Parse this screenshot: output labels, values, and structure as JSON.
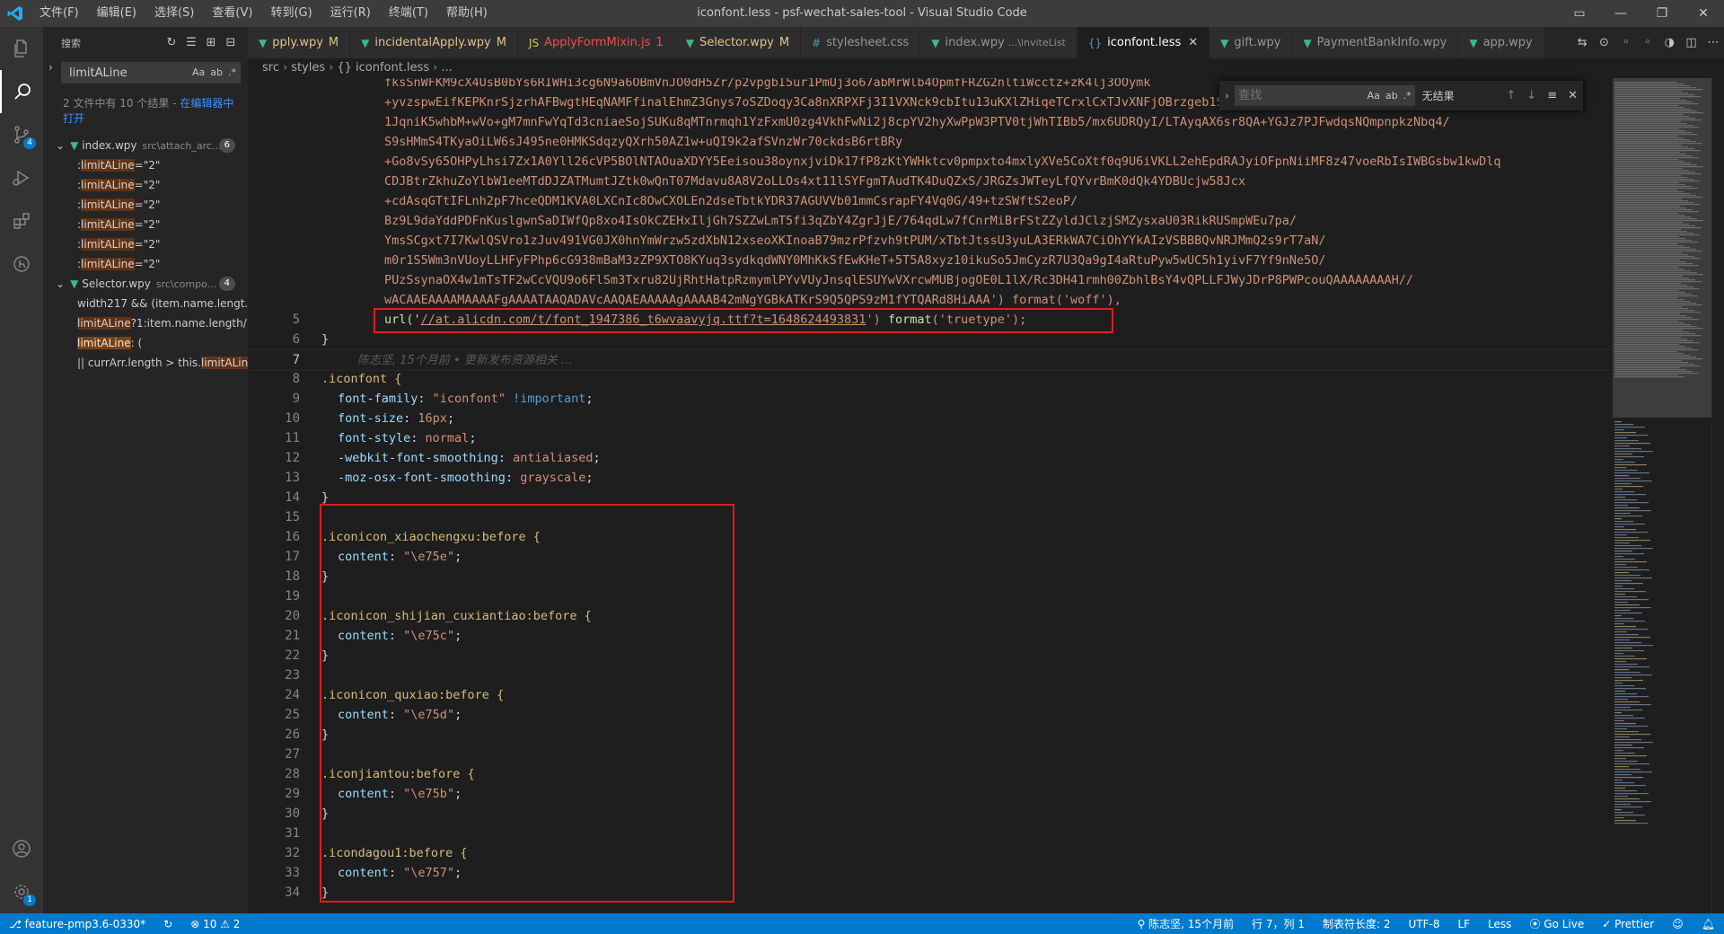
{
  "window": {
    "title": "iconfont.less - psf-wechat-sales-tool - Visual Studio Code",
    "menu": [
      "文件(F)",
      "编辑(E)",
      "选择(S)",
      "查看(V)",
      "转到(G)",
      "运行(R)",
      "终端(T)",
      "帮助(H)"
    ]
  },
  "sidebar": {
    "title": "搜索",
    "search_value": "limitALine",
    "result_message": "2 文件中有 10 个结果 - ",
    "open_in_editor": "在编辑器中打开",
    "files": [
      {
        "name": "index.wpy",
        "path": "src\\attach_arc...",
        "count": "6",
        "matches": [
          ":limitALine=\"2\"",
          ":limitALine=\"2\"",
          ":limitALine=\"2\"",
          ":limitALine=\"2\"",
          ":limitALine=\"2\"",
          ":limitALine=\"2\""
        ]
      },
      {
        "name": "Selector.wpy",
        "path": "src\\compo...",
        "count": "4",
        "matches": [
          "width217 && (item.name.lengt...",
          "limitALine?1:item.name.length/...",
          "limitALine: (",
          "|| currArr.length > this.limitALin..."
        ]
      }
    ]
  },
  "tabs": [
    {
      "label": "pply.wpy",
      "mod": "M",
      "icon": "vue",
      "color": "#e2c08d"
    },
    {
      "label": "incidentalApply.wpy",
      "mod": "M",
      "icon": "vue",
      "color": "#e2c08d"
    },
    {
      "label": "ApplyFormMixin.js",
      "mod": "1",
      "icon": "js",
      "color": "#f14c4c"
    },
    {
      "label": "Selector.wpy",
      "mod": "M",
      "icon": "vue",
      "color": "#e2c08d"
    },
    {
      "label": "stylesheet.css",
      "mod": "",
      "icon": "css",
      "color": "#969696"
    },
    {
      "label": "index.wpy",
      "desc": "...\\inviteList",
      "mod": "",
      "icon": "vue",
      "color": "#969696"
    },
    {
      "label": "iconfont.less",
      "mod": "",
      "icon": "less",
      "color": "#ffffff",
      "active": true
    },
    {
      "label": "gift.wpy",
      "mod": "",
      "icon": "vue",
      "color": "#969696"
    },
    {
      "label": "PaymentBankInfo.wpy",
      "mod": "",
      "icon": "vue",
      "color": "#969696"
    },
    {
      "label": "app.wpy",
      "mod": "",
      "icon": "vue",
      "color": "#969696"
    }
  ],
  "breadcrumb": [
    "src",
    "styles",
    "{} iconfont.less",
    "..."
  ],
  "find": {
    "placeholder": "查找",
    "result": "无结果"
  },
  "editor": {
    "base64_lines": [
      "fksSnWFKM9cX4UsB0bYs6RIWHi3cg6N9a6OBmVnJO0dH5Zr/p2vpgbI5ur1PmUj3o67abMrWlb4OpmfFRZG2nltiWcctz+zK4lj3OOymk",
      "+yvzspwEifKEPKnrSjzrhAFBwgtHEqNAMFfinalEhmZ3Gnys7oSZDoqy3Ca8nXRPXFj3I1VXNck9cbItu13uKXlZHiqeTCrxlCxTJvXNFjOBrzgeb1Sddq9zqs01H1Ymmaqr5CG/bJ3PBFTs1/",
      "1JqniK5whbM+wVo+gM7mnFwYqTd3cniaeSojSUKu8qMTnrmqh1YzFxmU0zg4VkhFwNi2j8cpYV2hyXwPpW3PTV0tjWhTIBb5/mx6UDRQyI/LTAyqAX6sr8QA+YGJz7PJFwdqsNQmpnpkzNbq4/",
      "S9sHMmS4TKyaOiLW6sJ495ne0HMKSdqzyQXrh50AZ1w+uQI9k2afSVnzWr70ckdsB6rtBRy",
      "+Go8vSy65OHPyLhsi7Zx1A0Yll26cVP5BOlNTAOuaXDYY5Eeisou38oynxjviDk17fP8zKtYWHktcv0pmpxto4mxlyXVe5CoXtf0q9U6iVKLL2ehEpdRAJyiOFpnNiiMF8z47voeRbIsIWBGsbw1kwDlq",
      "CDJBtrZkhuZoYlbW1eeMTdDJZATMumtJZtk0wQnT07Mdavu8A8V2oLLOs4xt11lSYFgmTAudTK4DuQZxS/JRGZsJWTeyLfQYvrBmK0dQk4YDBUcjw58Jcx",
      "+cdAsqGTtIFLnh2pF7hceQDM1KVA0LXCnIc8OwCXOLEn2dseTbtkYDR37AGUVVb01mmCsrapFY4Vq0G/49+tzSWftS2eoP/",
      "Bz9L9daYddPDFnKuslgwnSaDIWfQp8xo4IsOkCZEHxIljGh7SZZwLmT5fi3qZbY4ZgrJjE/764qdLw7fCnrMiBrFStZZyldJClzjSMZysxaU03RikRUSmpWEu7pa/",
      "YmsSCgxt7I7KwlQSVro1zJuv491VG0JX0hnYmWrzw5zdXbN12xseoXKInoaB79mzrPfzvh9tPUM/xTbtJtssU3yuLA3ERkWA7CiOhYYkAIzVSBBBQvNRJMmQ2s9rT7aN/",
      "m0r1S5Wm3nVUoyLLHFyFPhp6cG938mBaM3zZP9XTO8KYuq3sydkqdWNY0MhKkSfEwKHeT+5T5A8xyz10ikuSo5JmCyzR7U3Qa9gI4aRtuPyw5wUC5h1yivF7Yf9nNe5O/",
      "PUzSsynaOX4w1mTsTF2wCcVQU9o6FlSm3Txru82UjRhtHatpRzmymlPYvVUyJnsqlESUYwVXrcwMUBjogOE0L1lX/Rc3DH41rmh00ZbhlBsY4vQPLLFJWyJDrP8PWPcouQAAAAAAAAH//",
      "wACAAEAAAAMAAAAFgAAAATAAQADAVcAAQAEAAAAAgAAAAB42mNgYGBkATKrS9Q5QPS9zM1fYTQARd8HiAAA') format('woff'),"
    ],
    "line5": {
      "prefix": "url('",
      "url": "//at.alicdn.com/t/font_1947386_t6wvaavyjq.ttf?t=1648624493831",
      "suffix": "') ",
      "fn": "format",
      "arg": "('truetype');"
    },
    "line6": "}",
    "blame": "陈志坚, 15个月前 • 更新发布资源相关 ...",
    "iconfont_block": {
      "selector": ".iconfont {",
      "props": [
        {
          "name": "font-family",
          "value": "\"iconfont\"",
          "extra": " !important"
        },
        {
          "name": "font-size",
          "value": "16px",
          "extra": ""
        },
        {
          "name": "font-style",
          "value": "normal",
          "extra": ""
        },
        {
          "name": "-webkit-font-smoothing",
          "value": "antialiased",
          "extra": ""
        },
        {
          "name": "-moz-osx-font-smoothing",
          "value": "grayscale",
          "extra": ""
        }
      ],
      "close": "}"
    },
    "icons": [
      {
        "selector": ".iconicon_xiaochengxu:before {",
        "content": "\"\\e75e\""
      },
      {
        "selector": ".iconicon_shijian_cuxiantiao:before {",
        "content": "\"\\e75c\""
      },
      {
        "selector": ".iconicon_quxiao:before {",
        "content": "\"\\e75d\""
      },
      {
        "selector": ".iconjiantou:before {",
        "content": "\"\\e75b\""
      },
      {
        "selector": ".icondagou1:before {",
        "content": "\"\\e757\""
      }
    ],
    "content_prop": "content",
    "close_brace": "}"
  },
  "status": {
    "branch": "feature-pmp3.6-0330*",
    "errors": "⊗ 10",
    "warnings": "⚠ 2",
    "blame": "陈志坚, 15个月前",
    "position": "行 7，列 1",
    "tabsize": "制表符长度: 2",
    "encoding": "UTF-8",
    "eol": "LF",
    "language": "Less",
    "golive": "Go Live",
    "prettier": "✓ Prettier"
  },
  "activity_badges": {
    "scm": "4",
    "settings": "1"
  },
  "colors": {
    "accent": "#007acc",
    "highlight_box": "#e51b1b"
  }
}
